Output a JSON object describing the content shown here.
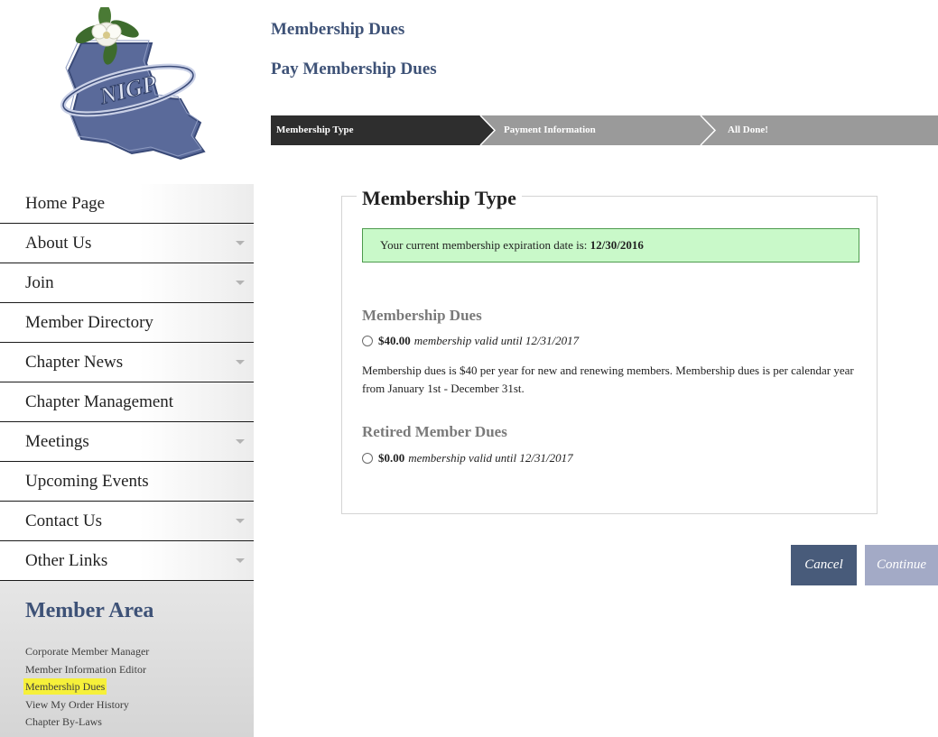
{
  "logo": {
    "text": "NIGP",
    "alt": "NIGP Louisiana chapter logo"
  },
  "nav": [
    {
      "label": "Home Page",
      "has_submenu": false
    },
    {
      "label": "About Us",
      "has_submenu": true
    },
    {
      "label": "Join",
      "has_submenu": true
    },
    {
      "label": "Member Directory",
      "has_submenu": false
    },
    {
      "label": "Chapter News",
      "has_submenu": true
    },
    {
      "label": "Chapter Management",
      "has_submenu": false
    },
    {
      "label": "Meetings",
      "has_submenu": true
    },
    {
      "label": "Upcoming Events",
      "has_submenu": false
    },
    {
      "label": "Contact Us",
      "has_submenu": true
    },
    {
      "label": "Other Links",
      "has_submenu": true
    }
  ],
  "member_area": {
    "title": "Member Area",
    "links": [
      "Corporate Member Manager",
      "Member Information Editor",
      "Membership Dues",
      "View My Order History",
      "Chapter By-Laws"
    ]
  },
  "page": {
    "title": "Membership Dues",
    "subtitle": "Pay Membership Dues"
  },
  "steps": [
    "Membership Type",
    "Payment Information",
    "All Done!"
  ],
  "form": {
    "legend": "Membership Type",
    "notice_prefix": "Your current membership expiration date is: ",
    "notice_date": "12/30/2016",
    "sections": [
      {
        "title": "Membership Dues",
        "price": "$40.00",
        "validity": "membership valid until 12/31/2017",
        "description": "Membership dues is $40 per year for new and renewing members.  Membership dues is per calendar year from January 1st - December 31st."
      },
      {
        "title": "Retired Member Dues",
        "price": "$0.00",
        "validity": "membership valid until 12/31/2017"
      }
    ]
  },
  "buttons": {
    "cancel": "Cancel",
    "continue": "Continue"
  },
  "colors": {
    "heading": "#3e5277",
    "step_active": "#2e2e2e",
    "step_inactive": "#9a9a9a",
    "notice_bg": "#c9f9c9",
    "notice_border": "#4d9a4d",
    "cancel_bg": "#485b7a",
    "continue_bg": "#a3aac6",
    "highlight": "#f6f03a"
  }
}
